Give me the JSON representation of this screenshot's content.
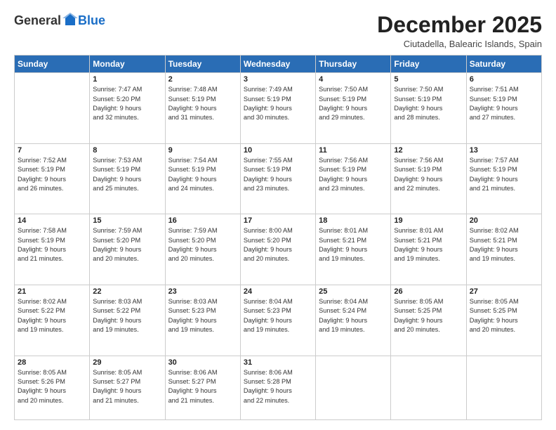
{
  "logo": {
    "general": "General",
    "blue": "Blue"
  },
  "header": {
    "month_year": "December 2025",
    "location": "Ciutadella, Balearic Islands, Spain"
  },
  "weekdays": [
    "Sunday",
    "Monday",
    "Tuesday",
    "Wednesday",
    "Thursday",
    "Friday",
    "Saturday"
  ],
  "weeks": [
    [
      {
        "day": null,
        "content": null
      },
      {
        "day": "1",
        "content": "Sunrise: 7:47 AM\nSunset: 5:20 PM\nDaylight: 9 hours\nand 32 minutes."
      },
      {
        "day": "2",
        "content": "Sunrise: 7:48 AM\nSunset: 5:19 PM\nDaylight: 9 hours\nand 31 minutes."
      },
      {
        "day": "3",
        "content": "Sunrise: 7:49 AM\nSunset: 5:19 PM\nDaylight: 9 hours\nand 30 minutes."
      },
      {
        "day": "4",
        "content": "Sunrise: 7:50 AM\nSunset: 5:19 PM\nDaylight: 9 hours\nand 29 minutes."
      },
      {
        "day": "5",
        "content": "Sunrise: 7:50 AM\nSunset: 5:19 PM\nDaylight: 9 hours\nand 28 minutes."
      },
      {
        "day": "6",
        "content": "Sunrise: 7:51 AM\nSunset: 5:19 PM\nDaylight: 9 hours\nand 27 minutes."
      }
    ],
    [
      {
        "day": "7",
        "content": "Sunrise: 7:52 AM\nSunset: 5:19 PM\nDaylight: 9 hours\nand 26 minutes."
      },
      {
        "day": "8",
        "content": "Sunrise: 7:53 AM\nSunset: 5:19 PM\nDaylight: 9 hours\nand 25 minutes."
      },
      {
        "day": "9",
        "content": "Sunrise: 7:54 AM\nSunset: 5:19 PM\nDaylight: 9 hours\nand 24 minutes."
      },
      {
        "day": "10",
        "content": "Sunrise: 7:55 AM\nSunset: 5:19 PM\nDaylight: 9 hours\nand 23 minutes."
      },
      {
        "day": "11",
        "content": "Sunrise: 7:56 AM\nSunset: 5:19 PM\nDaylight: 9 hours\nand 23 minutes."
      },
      {
        "day": "12",
        "content": "Sunrise: 7:56 AM\nSunset: 5:19 PM\nDaylight: 9 hours\nand 22 minutes."
      },
      {
        "day": "13",
        "content": "Sunrise: 7:57 AM\nSunset: 5:19 PM\nDaylight: 9 hours\nand 21 minutes."
      }
    ],
    [
      {
        "day": "14",
        "content": "Sunrise: 7:58 AM\nSunset: 5:19 PM\nDaylight: 9 hours\nand 21 minutes."
      },
      {
        "day": "15",
        "content": "Sunrise: 7:59 AM\nSunset: 5:20 PM\nDaylight: 9 hours\nand 20 minutes."
      },
      {
        "day": "16",
        "content": "Sunrise: 7:59 AM\nSunset: 5:20 PM\nDaylight: 9 hours\nand 20 minutes."
      },
      {
        "day": "17",
        "content": "Sunrise: 8:00 AM\nSunset: 5:20 PM\nDaylight: 9 hours\nand 20 minutes."
      },
      {
        "day": "18",
        "content": "Sunrise: 8:01 AM\nSunset: 5:21 PM\nDaylight: 9 hours\nand 19 minutes."
      },
      {
        "day": "19",
        "content": "Sunrise: 8:01 AM\nSunset: 5:21 PM\nDaylight: 9 hours\nand 19 minutes."
      },
      {
        "day": "20",
        "content": "Sunrise: 8:02 AM\nSunset: 5:21 PM\nDaylight: 9 hours\nand 19 minutes."
      }
    ],
    [
      {
        "day": "21",
        "content": "Sunrise: 8:02 AM\nSunset: 5:22 PM\nDaylight: 9 hours\nand 19 minutes."
      },
      {
        "day": "22",
        "content": "Sunrise: 8:03 AM\nSunset: 5:22 PM\nDaylight: 9 hours\nand 19 minutes."
      },
      {
        "day": "23",
        "content": "Sunrise: 8:03 AM\nSunset: 5:23 PM\nDaylight: 9 hours\nand 19 minutes."
      },
      {
        "day": "24",
        "content": "Sunrise: 8:04 AM\nSunset: 5:23 PM\nDaylight: 9 hours\nand 19 minutes."
      },
      {
        "day": "25",
        "content": "Sunrise: 8:04 AM\nSunset: 5:24 PM\nDaylight: 9 hours\nand 19 minutes."
      },
      {
        "day": "26",
        "content": "Sunrise: 8:05 AM\nSunset: 5:25 PM\nDaylight: 9 hours\nand 20 minutes."
      },
      {
        "day": "27",
        "content": "Sunrise: 8:05 AM\nSunset: 5:25 PM\nDaylight: 9 hours\nand 20 minutes."
      }
    ],
    [
      {
        "day": "28",
        "content": "Sunrise: 8:05 AM\nSunset: 5:26 PM\nDaylight: 9 hours\nand 20 minutes."
      },
      {
        "day": "29",
        "content": "Sunrise: 8:05 AM\nSunset: 5:27 PM\nDaylight: 9 hours\nand 21 minutes."
      },
      {
        "day": "30",
        "content": "Sunrise: 8:06 AM\nSunset: 5:27 PM\nDaylight: 9 hours\nand 21 minutes."
      },
      {
        "day": "31",
        "content": "Sunrise: 8:06 AM\nSunset: 5:28 PM\nDaylight: 9 hours\nand 22 minutes."
      },
      {
        "day": null,
        "content": null
      },
      {
        "day": null,
        "content": null
      },
      {
        "day": null,
        "content": null
      }
    ]
  ]
}
